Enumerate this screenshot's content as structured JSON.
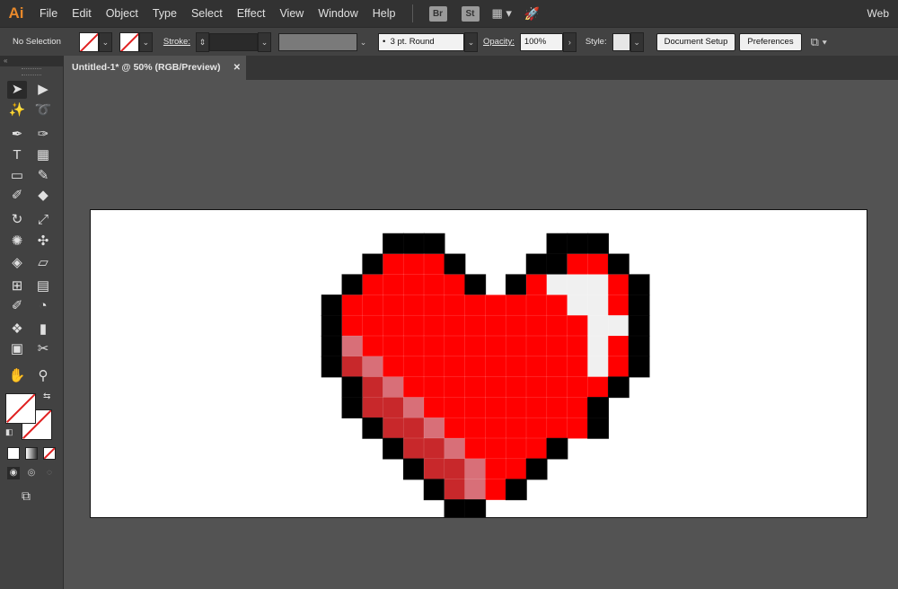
{
  "app": {
    "logo_text": "Ai",
    "menus": [
      "File",
      "Edit",
      "Object",
      "Type",
      "Select",
      "Effect",
      "View",
      "Window",
      "Help"
    ],
    "bridge_label": "Br",
    "stock_label": "St",
    "workspace_label": "Web"
  },
  "control_bar": {
    "selection_status": "No Selection",
    "stroke_label": "Stroke:",
    "brush_label": "3 pt. Round",
    "opacity_label": "Opacity:",
    "opacity_value": "100%",
    "style_label": "Style:",
    "document_setup_label": "Document Setup",
    "preferences_label": "Preferences"
  },
  "document_tab": {
    "title": "Untitled-1* @ 50% (RGB/Preview)",
    "close_glyph": "✕"
  },
  "tools": [
    {
      "name": "selection-tool",
      "glyph": "➤"
    },
    {
      "name": "direct-selection-tool",
      "glyph": "▶"
    },
    {
      "name": "magic-wand-tool",
      "glyph": "✨"
    },
    {
      "name": "lasso-tool",
      "glyph": "➰"
    },
    {
      "name": "pen-tool",
      "glyph": "✒"
    },
    {
      "name": "curvature-tool",
      "glyph": "✑"
    },
    {
      "name": "type-tool",
      "glyph": "T"
    },
    {
      "name": "line-tool",
      "glyph": "▦"
    },
    {
      "name": "rectangle-tool",
      "glyph": "▭"
    },
    {
      "name": "paintbrush-tool",
      "glyph": "✎"
    },
    {
      "name": "shaper-tool",
      "glyph": "✐"
    },
    {
      "name": "eraser-tool",
      "glyph": "◆"
    },
    {
      "name": "rotate-tool",
      "glyph": "↻"
    },
    {
      "name": "scale-tool",
      "glyph": "⤢"
    },
    {
      "name": "warp-tool",
      "glyph": "✺"
    },
    {
      "name": "free-transform-tool",
      "glyph": "✣"
    },
    {
      "name": "shape-builder-tool",
      "glyph": "◈"
    },
    {
      "name": "perspective-grid-tool",
      "glyph": "▱"
    },
    {
      "name": "mesh-tool",
      "glyph": "⊞"
    },
    {
      "name": "gradient-tool",
      "glyph": "▤"
    },
    {
      "name": "eyedropper-tool",
      "glyph": "✐"
    },
    {
      "name": "blend-tool",
      "glyph": "◔"
    },
    {
      "name": "symbol-sprayer-tool",
      "glyph": "❖"
    },
    {
      "name": "column-graph-tool",
      "glyph": "▮"
    },
    {
      "name": "artboard-tool",
      "glyph": "▣"
    },
    {
      "name": "slice-tool",
      "glyph": "✂"
    },
    {
      "name": "hand-tool",
      "glyph": "✋"
    },
    {
      "name": "zoom-tool",
      "glyph": "⚲"
    }
  ],
  "colors": {
    "menubar_bg": "#323232",
    "panel_bg": "#424242",
    "canvas_bg": "#535353",
    "artboard_bg": "#ffffff",
    "pixel_red": "#ff0000",
    "pixel_black": "#000000",
    "pixel_highlight": "#f0f0f0",
    "pixel_shadow_dark": "#c8282b",
    "pixel_shadow_light": "#d86f78"
  },
  "artwork": {
    "name": "pixel-heart",
    "columns": 16,
    "rows": 13,
    "palette": {
      "B": "#000000",
      "R": "#ff0000",
      "W": "#f0f0f0",
      "D": "#c8282b",
      "L": "#d86f78",
      ".": null
    },
    "grid": [
      "...BBB.....BBB..",
      "..BRRRB...BBRRB.",
      ".BRRRRRB.BRWWWRB",
      "BRRRRRRRRRRRWWRB",
      "BRRRRRRRRRRRRWWB",
      "BLRRRRRRRRRRRWRB",
      "BDLRRRRRRRRRRWRB",
      ".BDLRRRRRRRRRRB.",
      ".BDDLRRRRRRRRB..",
      "..BDDLRRRRRRRB..",
      "...BDDLRRRRB....",
      "....BDDLRRB.....",
      ".....BDLRB......",
      "......BB........"
    ]
  }
}
